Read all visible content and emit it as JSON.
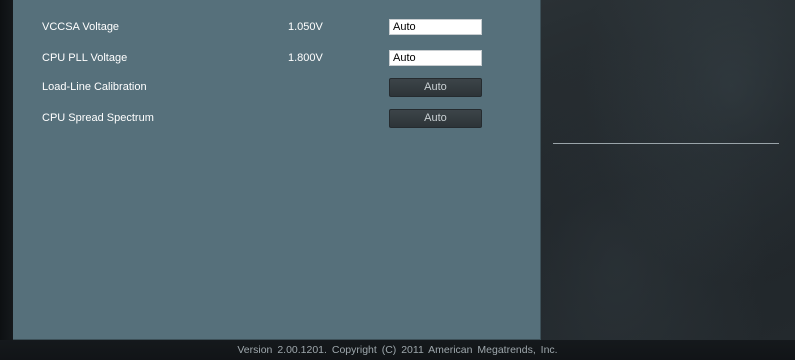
{
  "settings": [
    {
      "label": "VCCSA Voltage",
      "value": "1.050V",
      "control": "input",
      "setting": "Auto"
    },
    {
      "label": "CPU PLL Voltage",
      "value": "1.800V",
      "control": "input",
      "setting": "Auto"
    },
    {
      "label": "Load-Line Calibration",
      "value": "",
      "control": "button",
      "setting": "Auto"
    },
    {
      "label": "CPU Spread Spectrum",
      "value": "",
      "control": "button",
      "setting": "Auto"
    }
  ],
  "footer": {
    "copyright": "Version 2.00.1201. Copyright (C) 2011 American Megatrends, Inc."
  }
}
